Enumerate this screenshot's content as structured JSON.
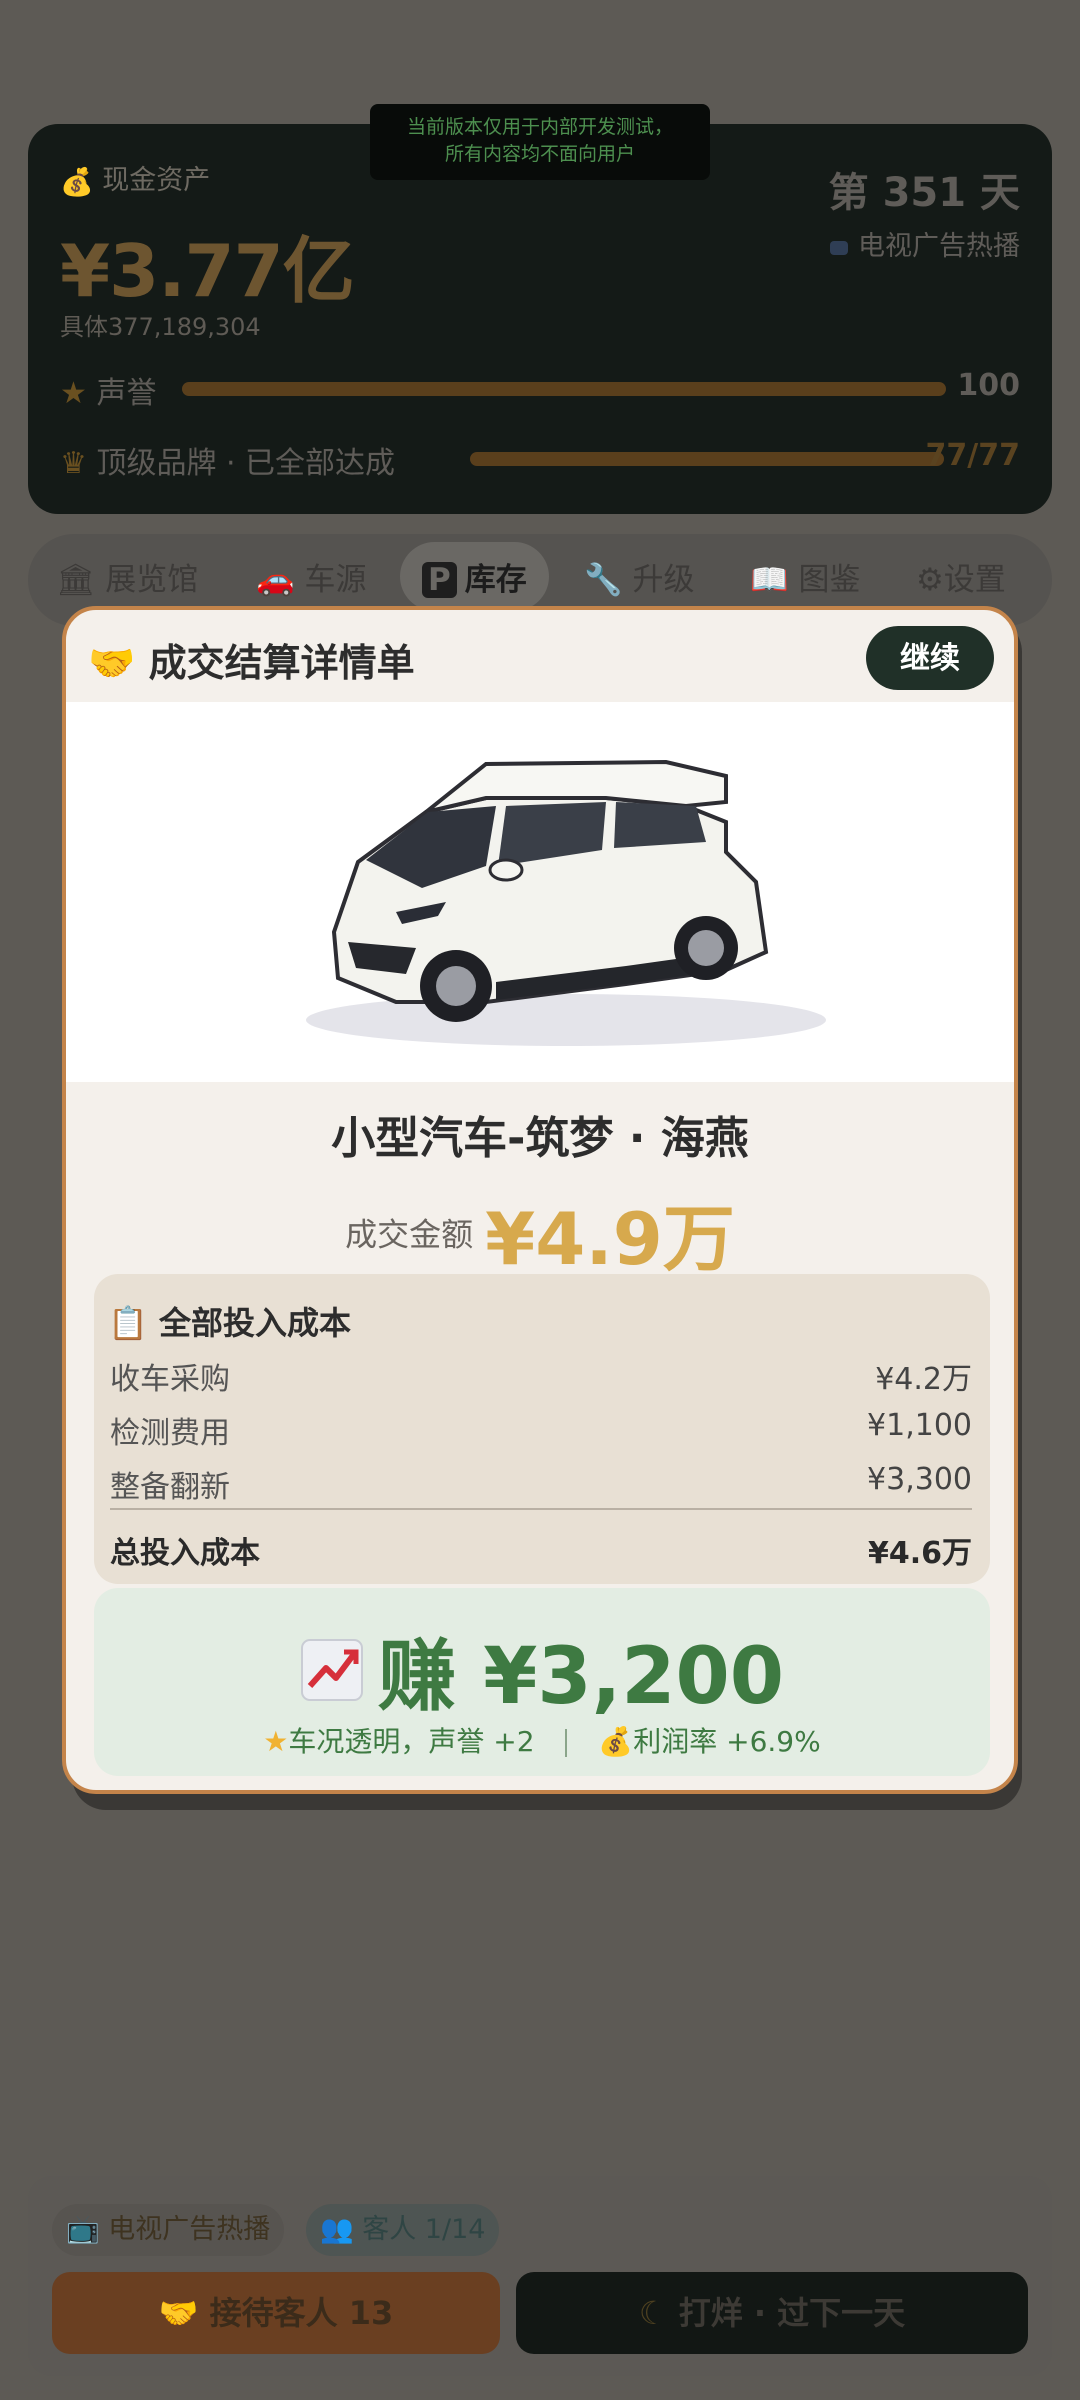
{
  "dev_notice": {
    "line1": "当前版本仅用于内部开发测试，",
    "line2": "所有内容均不面向用户"
  },
  "stats": {
    "cash_label": "现金资产",
    "cash_amount": "¥3.77亿",
    "cash_detail": "具体377,189,304",
    "day_label": "第 351 天",
    "ad_status": "电视广告热播",
    "reputation_label": "声誉",
    "reputation_value": "100",
    "reputation_fraction": 1.0,
    "brand_label": "顶级品牌 · 已全部达成",
    "brand_value": "77/77",
    "brand_fraction": 1.0
  },
  "nav": {
    "tabs": [
      {
        "label": "展览馆",
        "icon": "museum-icon"
      },
      {
        "label": "车源",
        "icon": "car-icon"
      },
      {
        "label": "库存",
        "icon": "parking-icon"
      },
      {
        "label": "升级",
        "icon": "wrench-icon"
      },
      {
        "label": "图鉴",
        "icon": "book-icon"
      },
      {
        "label": "设置",
        "icon": "gear-icon"
      }
    ],
    "active": "库存"
  },
  "modal": {
    "title": "成交结算详情单",
    "title_icon": "handshake-icon",
    "continue_label": "继续",
    "car_name": "小型汽车-筑梦 · 海燕",
    "deal_label": "成交金额",
    "deal_amount": "¥4.9万",
    "cost": {
      "title": "全部投入成本",
      "title_icon": "clipboard-icon",
      "rows": [
        {
          "label": "收车采购",
          "value": "¥4.2万"
        },
        {
          "label": "检测费用",
          "value": "¥1,100"
        },
        {
          "label": "整备翻新",
          "value": "¥3,300"
        }
      ],
      "total_label": "总投入成本",
      "total_value": "¥4.6万"
    },
    "profit": {
      "text": "赚 ¥3,200",
      "icon": "chart-up-icon",
      "reputation_note": "车况透明，声誉 +2",
      "margin_note": "利润率 +6.9%"
    }
  },
  "bottom": {
    "ad_chip": "电视广告热播",
    "guest_chip": "客人 1/14",
    "receive_button": "接待客人 13",
    "close_button": "打烊 · 过下一天"
  },
  "colors": {
    "accent_gold": "#d7a94d",
    "profit_green": "#3e7a42",
    "modal_border": "#c4844a",
    "continue_button": "#203028"
  }
}
